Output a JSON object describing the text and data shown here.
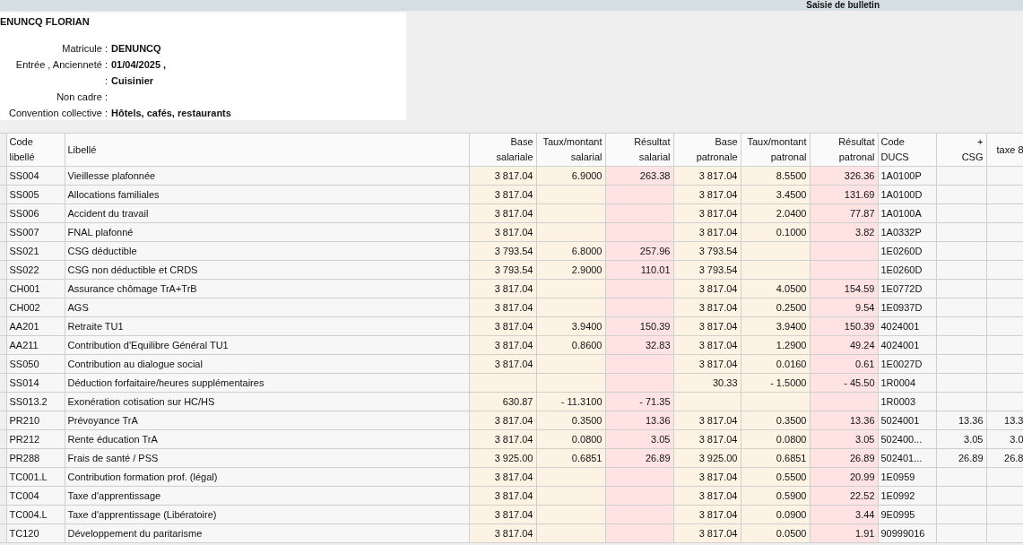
{
  "window": {
    "title": "Saisie de bulletin"
  },
  "employee": {
    "name": "ENUNCQ FLORIAN",
    "fields": [
      {
        "label": "Matricule :",
        "value": "DENUNCQ"
      },
      {
        "label": "Entrée , Ancienneté :",
        "value": "01/04/2025 ,"
      },
      {
        "label": ":",
        "value": "Cuisinier"
      },
      {
        "label": "Non cadre :"
      },
      {
        "label": "Convention collective :",
        "value": "Hôtels, cafés, restaurants"
      }
    ]
  },
  "table": {
    "columns": [
      {
        "kind": "code",
        "header": [
          "Code",
          "libellé"
        ]
      },
      {
        "kind": "text",
        "header": [
          "Libellé"
        ]
      },
      {
        "kind": "amount",
        "header": [
          "Base",
          "salariale"
        ]
      },
      {
        "kind": "rate",
        "header": [
          "Taux/montant",
          "salarial"
        ]
      },
      {
        "kind": "result",
        "header": [
          "Résultat",
          "salarial"
        ]
      },
      {
        "kind": "amount",
        "header": [
          "Base",
          "patronale"
        ]
      },
      {
        "kind": "rate",
        "header": [
          "Taux/montant",
          "patronal"
        ]
      },
      {
        "kind": "result",
        "header": [
          "Résultat",
          "patronal"
        ]
      },
      {
        "kind": "code",
        "header": [
          "Code",
          "DUCS"
        ]
      },
      {
        "kind": "number",
        "header": [
          "+",
          "CSG"
        ]
      },
      {
        "kind": "number",
        "header": [
          "taxe 8"
        ]
      }
    ],
    "rows": [
      {
        "cells": [
          "SS004",
          "Vieillesse plafonnée",
          "3 817.04",
          "6.9000",
          "263.38",
          "3 817.04",
          "8.5500",
          "326.36",
          "1A0100P",
          null,
          null
        ]
      },
      {
        "cells": [
          "SS005",
          "Allocations familiales",
          "3 817.04",
          null,
          null,
          "3 817.04",
          "3.4500",
          "131.69",
          "1A0100D",
          null,
          null
        ]
      },
      {
        "cells": [
          "SS006",
          "Accident du travail",
          "3 817.04",
          null,
          null,
          "3 817.04",
          "2.0400",
          "77.87",
          "1A0100A",
          null,
          null
        ]
      },
      {
        "cells": [
          "SS007",
          "FNAL plafonné",
          "3 817.04",
          null,
          null,
          "3 817.04",
          "0.1000",
          "3.82",
          "1A0332P",
          null,
          null
        ]
      },
      {
        "cells": [
          "SS021",
          "CSG déductible",
          "3 793.54",
          "6.8000",
          "257.96",
          "3 793.54",
          null,
          null,
          "1E0260D",
          null,
          null
        ]
      },
      {
        "cells": [
          "SS022",
          "CSG non déductible et CRDS",
          "3 793.54",
          "2.9000",
          "110.01",
          "3 793.54",
          null,
          null,
          "1E0260D",
          null,
          null
        ]
      },
      {
        "cells": [
          "CH001",
          "Assurance chômage TrA+TrB",
          "3 817.04",
          null,
          null,
          "3 817.04",
          "4.0500",
          "154.59",
          "1E0772D",
          null,
          null
        ]
      },
      {
        "cells": [
          "CH002",
          "AGS",
          "3 817.04",
          null,
          null,
          "3 817.04",
          "0.2500",
          "9.54",
          "1E0937D",
          null,
          null
        ]
      },
      {
        "cells": [
          "AA201",
          "Retraite TU1",
          "3 817.04",
          "3.9400",
          "150.39",
          "3 817.04",
          "3.9400",
          "150.39",
          "4024001",
          null,
          null
        ]
      },
      {
        "cells": [
          "AA211",
          "Contribution d'Equilibre Général TU1",
          "3 817.04",
          "0.8600",
          "32.83",
          "3 817.04",
          "1.2900",
          "49.24",
          "4024001",
          null,
          null
        ]
      },
      {
        "cells": [
          "SS050",
          "Contribution au dialogue social",
          "3 817.04",
          null,
          null,
          "3 817.04",
          "0.0160",
          "0.61",
          "1E0027D",
          null,
          null
        ]
      },
      {
        "cells": [
          "SS014",
          "Déduction forfaitaire/heures supplémentaires",
          null,
          null,
          null,
          "30.33",
          "- 1.5000",
          "- 45.50",
          "1R0004",
          null,
          null
        ]
      },
      {
        "cells": [
          "SS013.2",
          "Exonération cotisation sur HC/HS",
          "630.87",
          "- 11.3100",
          "- 71.35",
          null,
          null,
          null,
          "1R0003",
          null,
          null
        ]
      },
      {
        "cells": [
          "PR210",
          "Prévoyance TrA",
          "3 817.04",
          "0.3500",
          "13.36",
          "3 817.04",
          "0.3500",
          "13.36",
          "5024001",
          "13.36",
          "13.3"
        ]
      },
      {
        "cells": [
          "PR212",
          "Rente éducation TrA",
          "3 817.04",
          "0.0800",
          "3.05",
          "3 817.04",
          "0.0800",
          "3.05",
          "502400...",
          "3.05",
          "3.0"
        ]
      },
      {
        "cells": [
          "PR288",
          "Frais de santé / PSS",
          "3 925.00",
          "0.6851",
          "26.89",
          "3 925.00",
          "0.6851",
          "26.89",
          "502401...",
          "26.89",
          "26.8"
        ]
      },
      {
        "cells": [
          "TC001.L",
          "Contribution formation prof. (légal)",
          "3 817.04",
          null,
          null,
          "3 817.04",
          "0.5500",
          "20.99",
          "1E0959",
          null,
          null
        ]
      },
      {
        "cells": [
          "TC004",
          "Taxe d'apprentissage",
          "3 817.04",
          null,
          null,
          "3 817.04",
          "0.5900",
          "22.52",
          "1E0992",
          null,
          null
        ]
      },
      {
        "cells": [
          "TC004.L",
          "Taxe d'apprentissage (Libératoire)",
          "3 817.04",
          null,
          null,
          "3 817.04",
          "0.0900",
          "3.44",
          "9E0995",
          null,
          null
        ]
      },
      {
        "cells": [
          "TC120",
          "Développement du paritarisme",
          "3 817.04",
          null,
          null,
          "3 817.04",
          "0.0500",
          "1.91",
          "90999016",
          null,
          null
        ]
      }
    ]
  }
}
